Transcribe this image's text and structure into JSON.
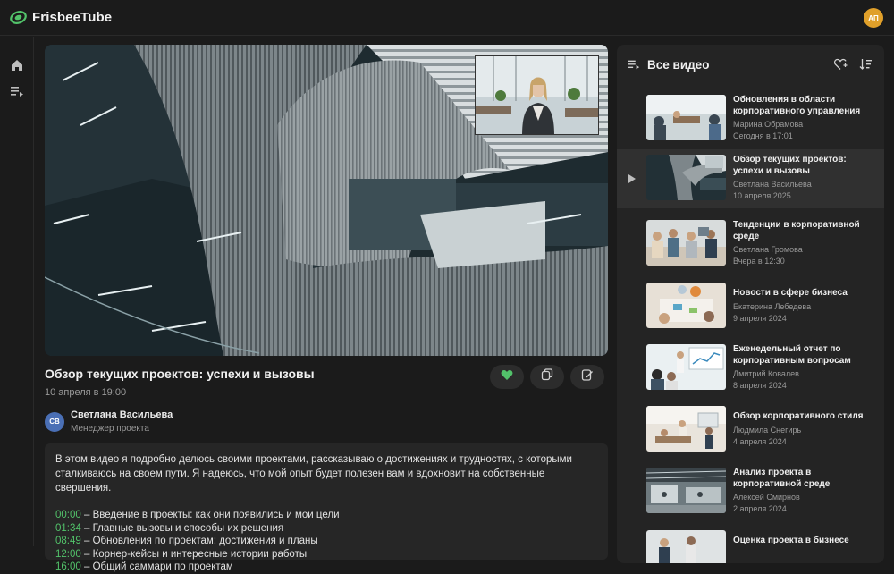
{
  "app": {
    "name": "FrisbeeTube",
    "user_initials": "АП"
  },
  "video": {
    "title": "Обзор текущих проектов: успехи и вызовы",
    "date": "10 апреля в 19:00",
    "author": {
      "initials": "СВ",
      "name": "Светлана Васильева",
      "role": "Менеджер проекта"
    },
    "description": "В этом видео я подробно делюсь своими проектами, рассказываю о достижениях и трудностях, с которыми сталкиваюсь на своем пути. Я надеюсь, что мой опыт будет полезен вам и вдохновит на собственные свершения.",
    "chapters": [
      {
        "time": "00:00",
        "label": " – Введение в проекты: как они появились и мои цели"
      },
      {
        "time": "01:34",
        "label": " – Главные вызовы и способы их решения"
      },
      {
        "time": "08:49",
        "label": " – Обновления по проектам: достижения и планы"
      },
      {
        "time": "12:00",
        "label": " – Корнер-кейсы и интересные истории работы"
      },
      {
        "time": "16:00",
        "label": " – Общий саммари по проектам"
      }
    ]
  },
  "playlist": {
    "title": "Все видео",
    "items": [
      {
        "title": "Обновления в области корпоративного управления",
        "author": "Марина Обрамова",
        "date": "Сегодня в 17:01"
      },
      {
        "title": "Обзор текущих проектов: успехи и вызовы",
        "author": "Светлана Васильева",
        "date": "10 апреля 2025"
      },
      {
        "title": "Тенденции в корпоративной среде",
        "author": "Светлана Громова",
        "date": "Вчера в 12:30"
      },
      {
        "title": "Новости в сфере бизнеса",
        "author": "Екатерина Лебедева",
        "date": "9 апреля 2024"
      },
      {
        "title": "Еженедельный отчет по корпоративным вопросам",
        "author": "Дмитрий Ковалев",
        "date": "8 апреля 2024"
      },
      {
        "title": "Обзор корпоративного стиля",
        "author": "Людмила Снегирь",
        "date": "4 апреля 2024"
      },
      {
        "title": "Анализ проекта в корпоративной среде",
        "author": "Алексей Смирнов",
        "date": "2 апреля 2024"
      },
      {
        "title": "Оценка проекта в бизнесе",
        "author": "",
        "date": ""
      }
    ]
  },
  "colors": {
    "accent": "#52c26a",
    "avatar_user": "#e0a02a",
    "avatar_author": "#4a6fb5"
  }
}
